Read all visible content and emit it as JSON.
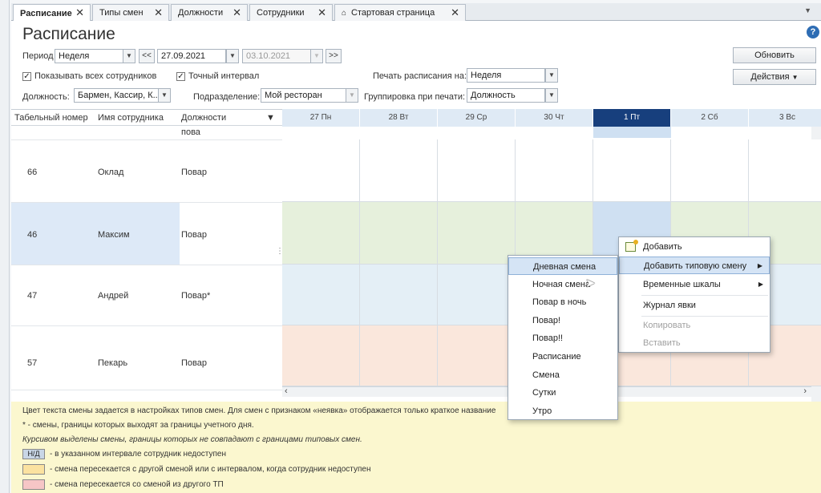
{
  "tabs": [
    {
      "label": "Расписание",
      "active": true
    },
    {
      "label": "Типы смен",
      "active": false
    },
    {
      "label": "Должности",
      "active": false
    },
    {
      "label": "Сотрудники",
      "active": false
    },
    {
      "label": "Стартовая страница",
      "active": false
    }
  ],
  "page_title": "Расписание",
  "filters": {
    "period_label": "Период",
    "period_value": "Неделя",
    "prev_button": "<<",
    "date_from": "27.09.2021",
    "date_to": "03.10.2021",
    "next_button": ">>",
    "show_all_label": "Показывать всех сотрудников",
    "show_all_checked": true,
    "exact_interval_label": "Точный интервал",
    "exact_interval_checked": true,
    "print_for_label": "Печать расписания на:",
    "print_for_value": "Неделя",
    "position_label": "Должность:",
    "position_value": "Бармен, Кассир, К...",
    "division_label": "Подразделение:",
    "division_value": "Мой ресторан",
    "grouping_label": "Группировка при печати:",
    "grouping_value": "Должность",
    "refresh_button": "Обновить",
    "actions_button": "Действия"
  },
  "left_table": {
    "headers": [
      "Табельный номер",
      "Имя сотрудника",
      "Должности"
    ],
    "partial_row_text": "пова",
    "rows": [
      {
        "id": "66",
        "name": "Оклад",
        "position": "Повар",
        "selected": false
      },
      {
        "id": "46",
        "name": "Максим",
        "position": "Повар",
        "selected": true
      },
      {
        "id": "47",
        "name": "Андрей",
        "position": "Повар*",
        "selected": false
      },
      {
        "id": "57",
        "name": "Пекарь",
        "position": "Повар",
        "selected": false
      }
    ]
  },
  "days": [
    "27 Пн",
    "28 Вт",
    "29 Ср",
    "30 Чт",
    "1 Пт",
    "2 Сб",
    "3 Вс"
  ],
  "today_index": 4,
  "row_colors": [
    "#ffffff",
    "#e6f0dc",
    "#e4eff6",
    "#fae7dc"
  ],
  "legend": {
    "line1": "Цвет текста смены задается в настройках типов смен. Для смен с признаком «неявка» отображается только краткое название",
    "line2": "* - смены, границы которых выходят за границы учетного дня.",
    "line3": "Курсивом выделены смены, границы которых не совпадают с границами типовых смен.",
    "nd_swatch": "Н/Д",
    "nd_text": "- в указанном интервале сотрудник недоступен",
    "yellow_text": "- смена пересекается с другой сменой или с интервалом, когда сотрудник недоступен",
    "pink_text": "- смена пересекается со сменой из другого ТП",
    "colors": {
      "nd": "#c9d6e6",
      "yellow": "#fbe2a0",
      "pink": "#f6c6c6"
    }
  },
  "context_menu": {
    "add": "Добавить",
    "add_typical": "Добавить типовую смену",
    "time_scales": "Временные шкалы",
    "attendance_log": "Журнал явки",
    "copy": "Копировать",
    "paste": "Вставить"
  },
  "submenu": [
    "Дневная смена",
    "Ночная смена",
    "Повар в ночь",
    "Повар!",
    "Повар!!",
    "Расписание",
    "Смена",
    "Сутки",
    "Утро"
  ],
  "submenu_highlight": 0
}
